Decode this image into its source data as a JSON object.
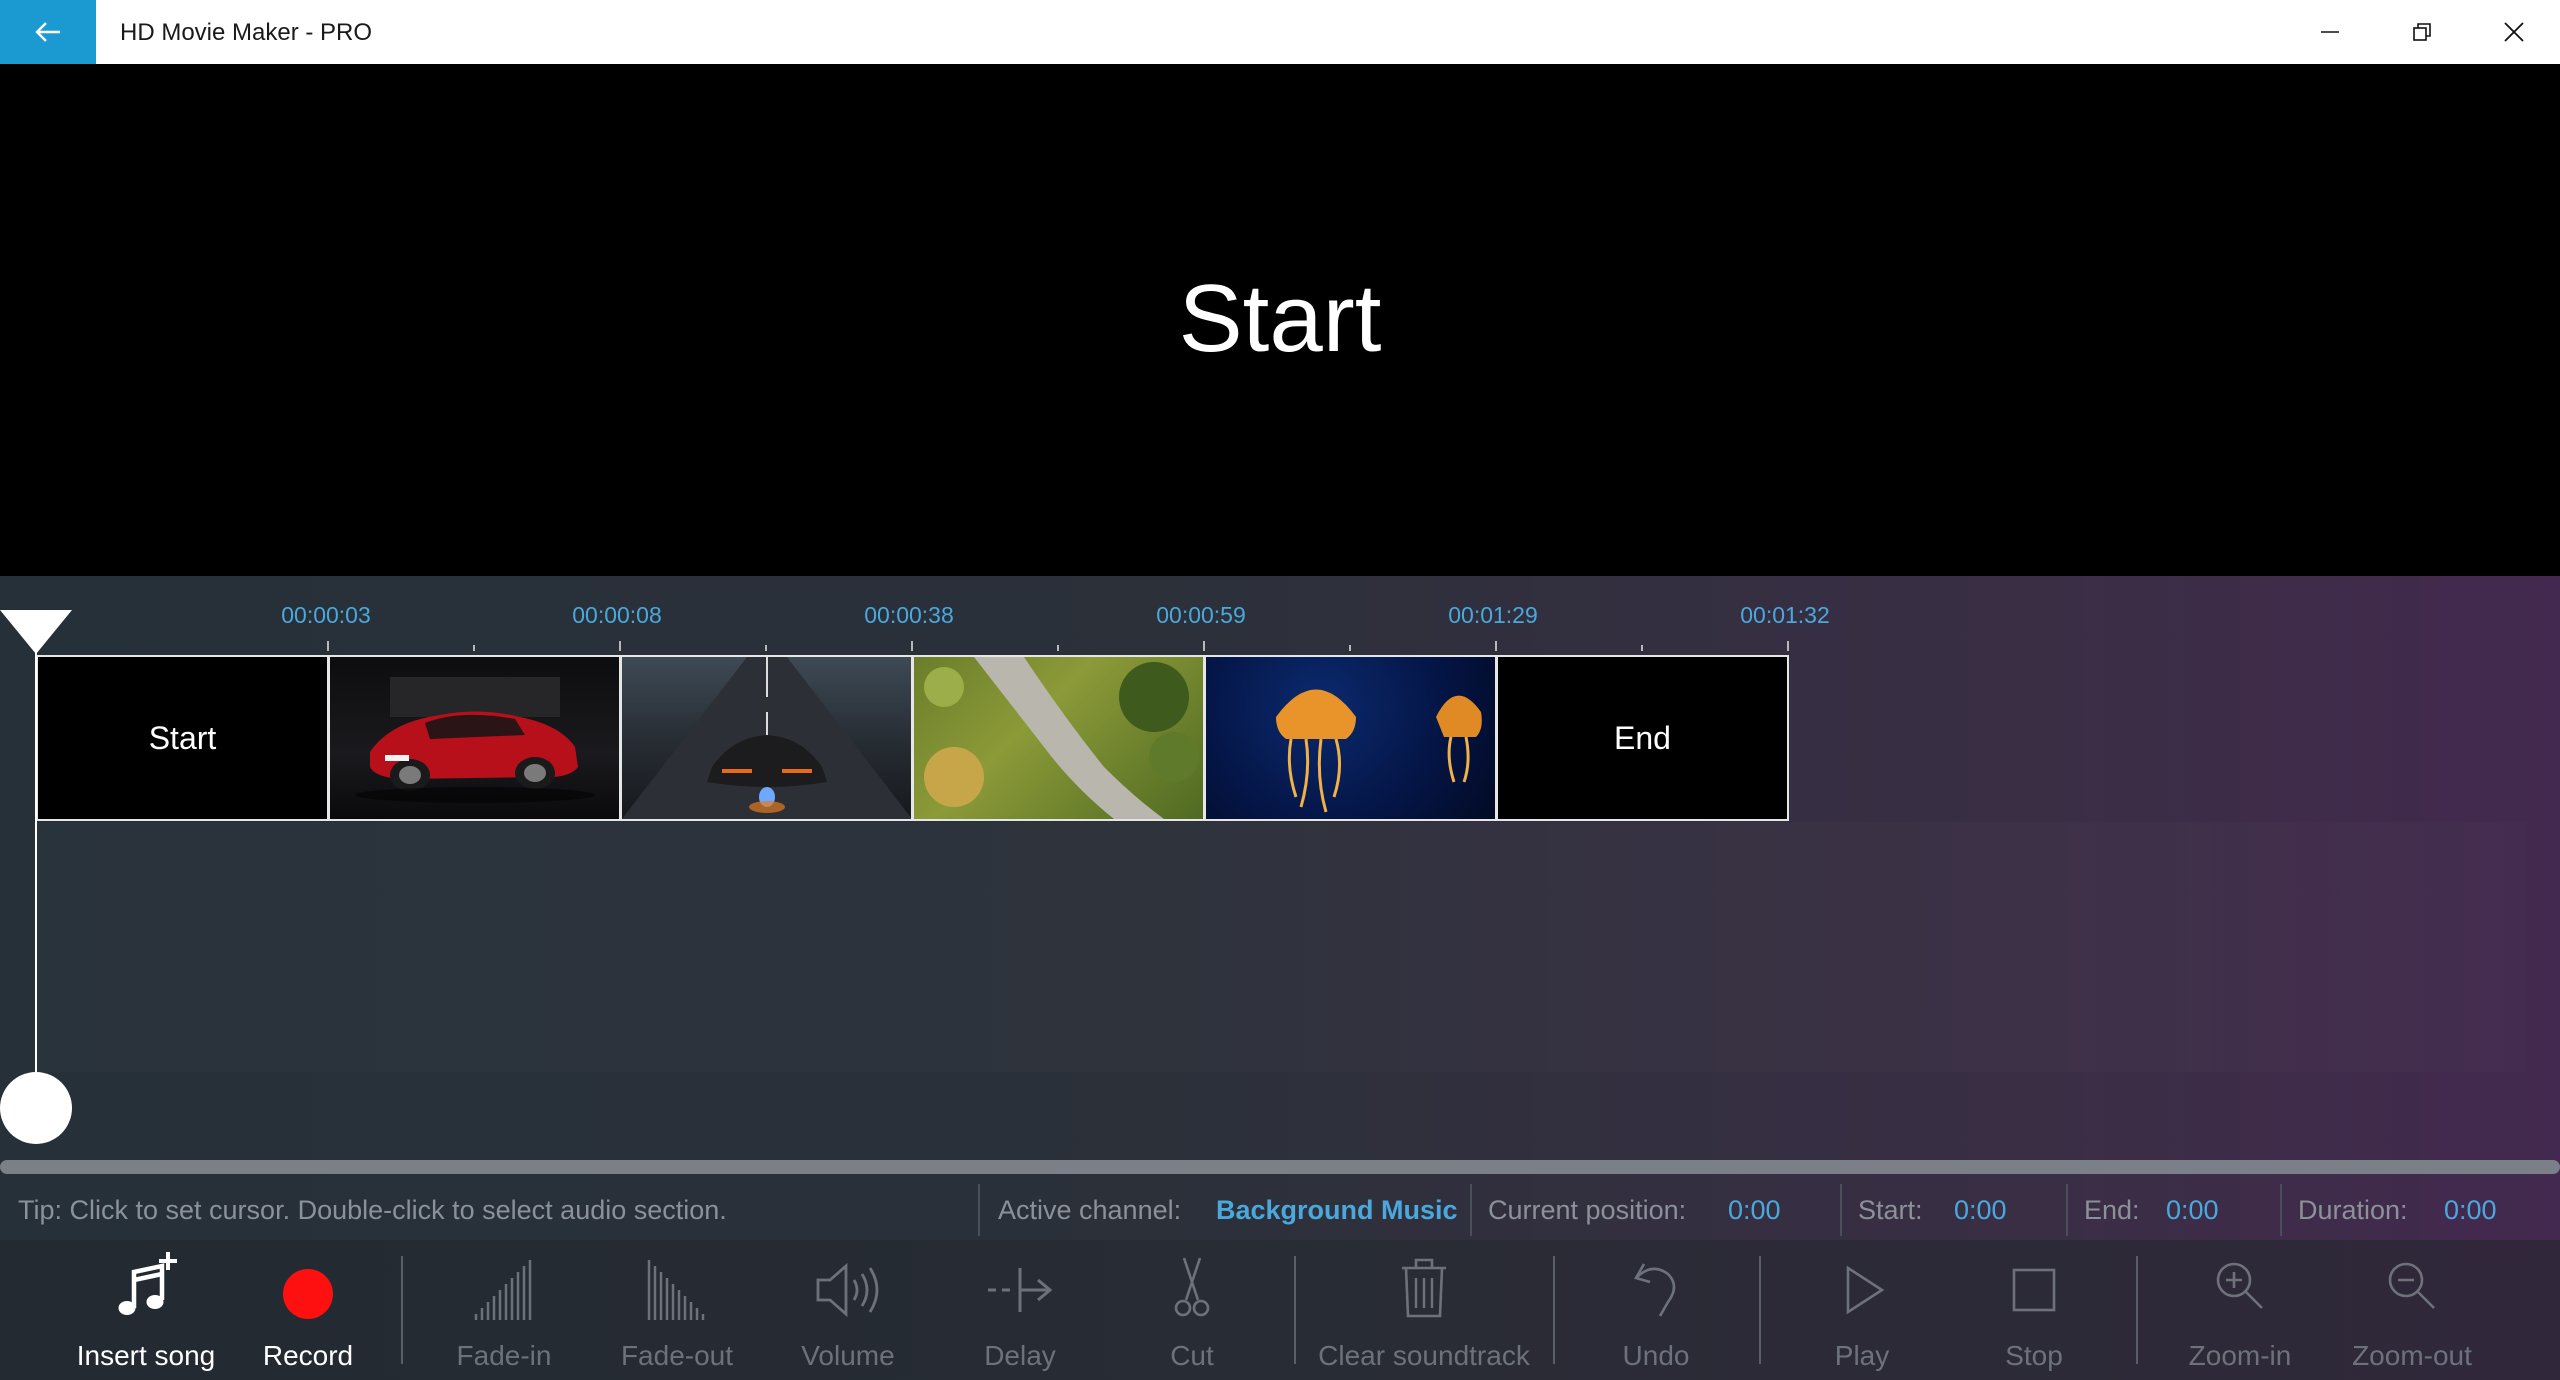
{
  "window": {
    "title": "HD Movie Maker - PRO",
    "accent_color": "#1a9ad0"
  },
  "preview": {
    "text": "Start"
  },
  "timeline": {
    "time_markers": [
      "00:00:03",
      "00:00:08",
      "00:00:38",
      "00:00:59",
      "00:01:29",
      "00:01:32"
    ],
    "clips": [
      {
        "type": "text",
        "label": "Start"
      },
      {
        "type": "image",
        "subject": "red-sedan-car"
      },
      {
        "type": "image",
        "subject": "black-supercar-road"
      },
      {
        "type": "image",
        "subject": "aerial-green-path"
      },
      {
        "type": "image",
        "subject": "jellyfish"
      },
      {
        "type": "text",
        "label": "End"
      }
    ]
  },
  "status": {
    "tip": "Tip: Click to set cursor. Double-click to select audio section.",
    "active_channel_label": "Active channel:",
    "active_channel_value": "Background Music",
    "current_position_label": "Current position:",
    "current_position_value": "0:00",
    "start_label": "Start:",
    "start_value": "0:00",
    "end_label": "End:",
    "end_value": "0:00",
    "duration_label": "Duration:",
    "duration_value": "0:00"
  },
  "toolbar": {
    "insert_song": "Insert song",
    "record": "Record",
    "fade_in": "Fade-in",
    "fade_out": "Fade-out",
    "volume": "Volume",
    "delay": "Delay",
    "cut": "Cut",
    "clear_soundtrack": "Clear soundtrack",
    "undo": "Undo",
    "play": "Play",
    "stop": "Stop",
    "zoom_in": "Zoom-in",
    "zoom_out": "Zoom-out",
    "record_color": "#ff0000"
  }
}
